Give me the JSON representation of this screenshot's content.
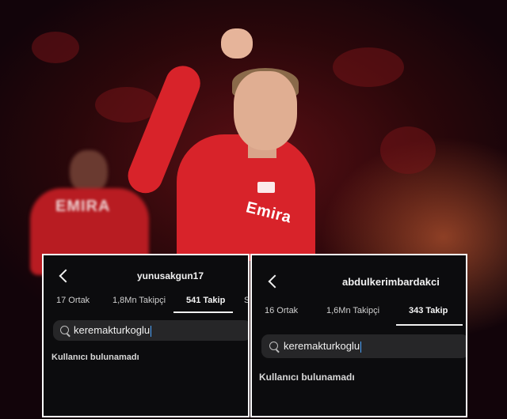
{
  "background_photo": {
    "shirt_text": "Emira",
    "colors": {
      "shirt": "#d8232a",
      "stadium": "#5a0f14"
    }
  },
  "panel_left": {
    "username": "yunusakgun17",
    "tabs": [
      "17 Ortak",
      "1,8Mn Takipçi",
      "541 Takip",
      "S"
    ],
    "active_tab": "541 Takip",
    "search_value": "keremakturkoglu",
    "result_text": "Kullanıcı bulunamadı"
  },
  "panel_right": {
    "username": "abdulkerimbardakci",
    "tabs": [
      "16 Ortak",
      "1,6Mn Takipçi",
      "343 Takip"
    ],
    "active_tab": "343 Takip",
    "search_value": "keremakturkoglu",
    "result_text": "Kullanıcı bulunamadı"
  }
}
